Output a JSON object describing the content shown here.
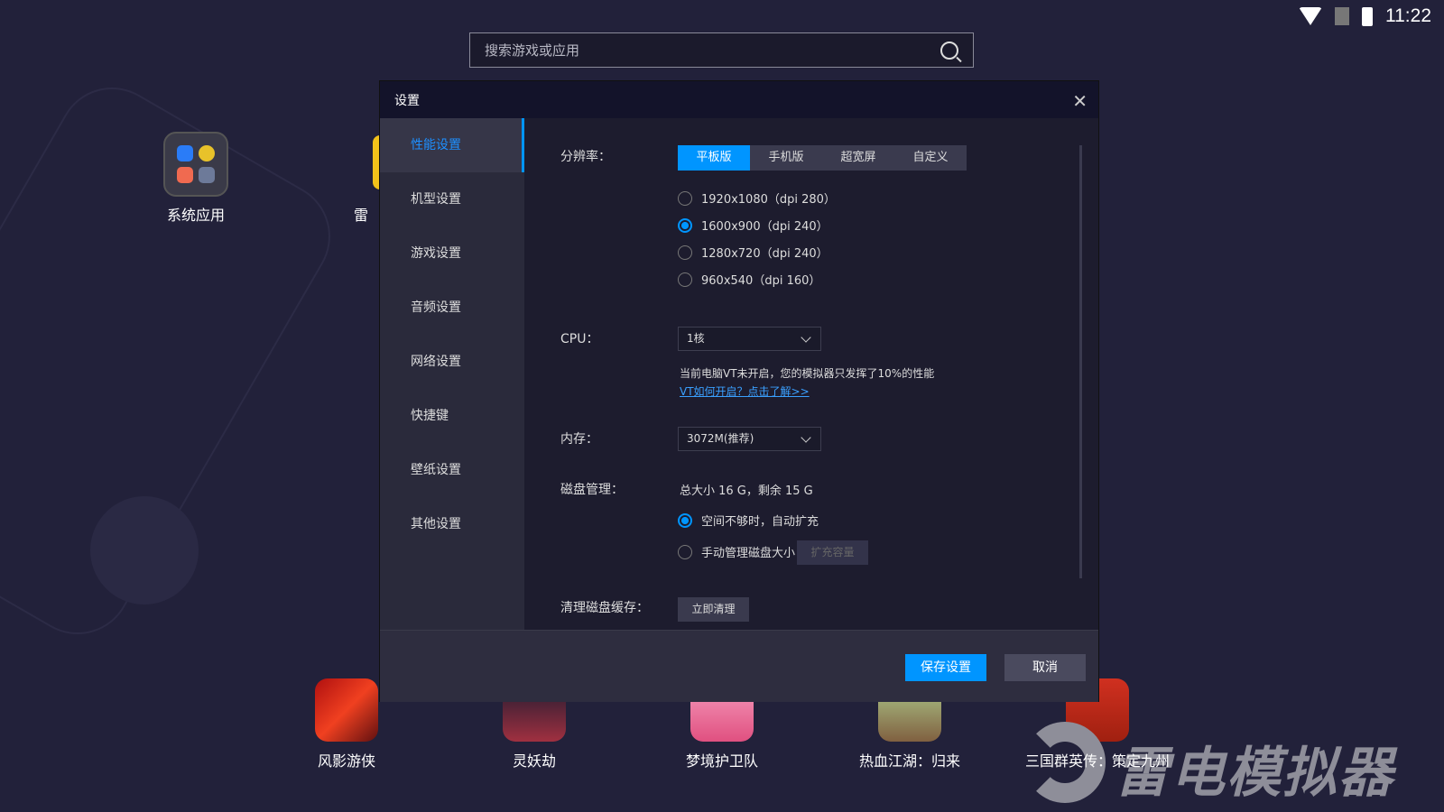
{
  "status": {
    "time": "11:22"
  },
  "search": {
    "placeholder": "搜索游戏或应用"
  },
  "desktop": {
    "folder_label": "系统应用",
    "partial_label": "雷"
  },
  "apps": [
    {
      "name": "风影游侠"
    },
    {
      "name": "灵妖劫"
    },
    {
      "name": "梦境护卫队"
    },
    {
      "name": "热血江湖：归来"
    },
    {
      "name": "三国群英传：策定九州"
    }
  ],
  "watermark": "雷电模拟器",
  "dialog": {
    "title": "设置",
    "sidebar": [
      "性能设置",
      "机型设置",
      "游戏设置",
      "音频设置",
      "网络设置",
      "快捷键",
      "壁纸设置",
      "其他设置"
    ],
    "resolution": {
      "label": "分辨率：",
      "tabs": [
        "平板版",
        "手机版",
        "超宽屏",
        "自定义"
      ],
      "options": [
        "1920x1080（dpi 280）",
        "1600x900（dpi 240）",
        "1280x720（dpi 240）",
        "960x540（dpi 160）"
      ],
      "selected": 1
    },
    "cpu": {
      "label": "CPU：",
      "value": "1核",
      "hint": "当前电脑VT未开启，您的模拟器只发挥了10%的性能",
      "link": "VT如何开启？点击了解>>"
    },
    "memory": {
      "label": "内存：",
      "value": "3072M(推荐)"
    },
    "disk": {
      "label": "磁盘管理：",
      "info": "总大小 16 G，剩余 15 G",
      "auto": "空间不够时，自动扩充",
      "manual": "手动管理磁盘大小",
      "expand": "扩充容量"
    },
    "cache": {
      "label": "清理磁盘缓存：",
      "button": "立即清理"
    },
    "save": "保存设置",
    "cancel": "取消"
  }
}
